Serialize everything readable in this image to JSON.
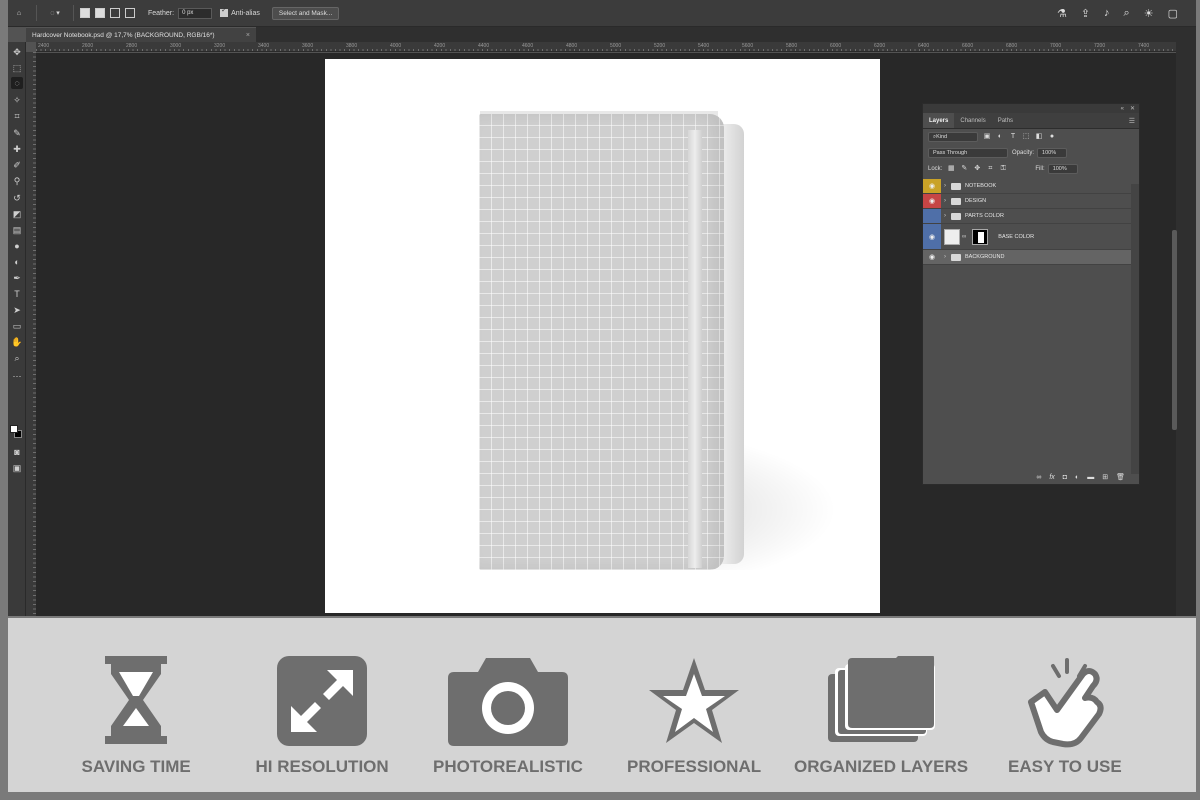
{
  "app": {
    "options_bar": {
      "feather_label": "Feather:",
      "feather_value": "0 px",
      "antialias_label": "Anti-alias",
      "select_mask_label": "Select and Mask..."
    },
    "document_tab": {
      "title": "Hardcover Notebook.psd @ 17,7% (BACKGROUND, RGB/16*)",
      "close": "×"
    },
    "ruler_ticks": [
      "2400",
      "2600",
      "2800",
      "3000",
      "3200",
      "3400",
      "3600",
      "3800",
      "4000",
      "4200",
      "4400",
      "4600",
      "4800",
      "5000",
      "5200",
      "5400",
      "5600",
      "5800",
      "6000",
      "6200",
      "6400",
      "6600",
      "6800",
      "7000",
      "7200",
      "7400"
    ]
  },
  "layers_panel": {
    "tabs": [
      "Layers",
      "Channels",
      "Paths"
    ],
    "filter_kind": "Kind",
    "blend_mode": "Pass Through",
    "opacity_label": "Opacity:",
    "opacity_value": "100%",
    "lock_label": "Lock:",
    "fill_label": "Fill:",
    "fill_value": "100%",
    "layers": [
      {
        "name": "NOTEBOOK",
        "color": "#c9a227"
      },
      {
        "name": "DESIGN",
        "color": "#c64545"
      },
      {
        "name": "PARTS COLOR",
        "color": "#4f6fa8"
      },
      {
        "name": "BASE COLOR",
        "color": "#4f6fa8"
      },
      {
        "name": "BACKGROUND",
        "color": ""
      }
    ]
  },
  "features": [
    {
      "label": "SAVING TIME",
      "icon": "hourglass-icon"
    },
    {
      "label": "HI RESOLUTION",
      "icon": "expand-icon"
    },
    {
      "label": "PHOTOREALISTIC",
      "icon": "camera-icon"
    },
    {
      "label": "PROFESSIONAL",
      "icon": "star-icon"
    },
    {
      "label": "ORGANIZED LAYERS",
      "icon": "layers-folder-icon"
    },
    {
      "label": "EASY TO USE",
      "icon": "tap-hand-icon"
    }
  ],
  "colors": {
    "workspace": "#282828",
    "panel": "#4e4e4e",
    "feature_icon": "#6e6e6e",
    "feature_bg": "#d4d4d4"
  }
}
